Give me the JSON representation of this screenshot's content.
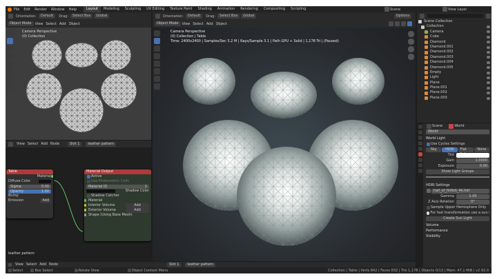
{
  "topbar": {
    "menus": [
      "File",
      "Edit",
      "Render",
      "Window",
      "Help"
    ],
    "workspaces": [
      "Layout",
      "Modeling",
      "Sculpting",
      "UV Editing",
      "Texture Paint",
      "Shading",
      "Animation",
      "Rendering",
      "Compositing",
      "Scripting"
    ],
    "active_workspace": "Layout",
    "scene": "Scene",
    "view_layer": "View Layer"
  },
  "left_viewport": {
    "header": {
      "orientation_label": "Orientation:",
      "orientation": "Default",
      "drag_label": "Drag:",
      "drag": "Select Box",
      "mode": "Object Mode",
      "menus": [
        "View",
        "Select",
        "Add",
        "Object"
      ],
      "transform": "Global"
    },
    "overlay_title": "Camera Perspective",
    "overlay_sub": "(0) Collection"
  },
  "render_viewport": {
    "header": {
      "orientation_label": "Orientation:",
      "orientation": "Default",
      "drag_label": "Drag:",
      "drag": "Select Box",
      "mode": "Object Mode",
      "menus": [
        "View",
        "Select",
        "Add",
        "Object"
      ],
      "transform": "Global",
      "options": "Options"
    },
    "overlay_title": "Camera Perspective",
    "overlay_sub": "(0) Collection | Table",
    "overlay_stats": "Time: 2400x2400 | Samples/Sec 3.2 M | Rays/Sample 3.1 | Path GPU + Solid | 1,178 Tri | (Paused)"
  },
  "node_editor": {
    "menus": [
      "View",
      "Select",
      "Add",
      "Node"
    ],
    "slot": "Slot 1",
    "material": "leather pattern",
    "label": "leather pattern",
    "node_table": {
      "title": "Table",
      "output": "Material",
      "rows": [
        {
          "label": "Diffuse Color",
          "value": ""
        },
        {
          "label": "Sigma",
          "value": "0.00"
        },
        {
          "label": "Opacity",
          "value": "1.00"
        },
        {
          "label": "Bump",
          "value": ""
        },
        {
          "label": "Emission",
          "value": "Add"
        }
      ]
    },
    "node_output": {
      "title": "Material Output",
      "active": "Active",
      "photo": "Use Photometric Cells",
      "slot": "Material ID",
      "slot_val": "1",
      "shadow_color": "Shadow Color",
      "shadow_catcher": "Shadow Catcher",
      "material": "Material",
      "interior": "Interior Volume",
      "interior_val": "Add",
      "exterior": "Exterior Volume",
      "exterior_val": "Add",
      "shape": "Shape (Using Base Mesh)"
    }
  },
  "bottom_bar": {
    "menus": [
      "View",
      "Select",
      "Add",
      "Node"
    ],
    "slot": "Slot 1",
    "material": "leather pattern",
    "status_left": [
      "Select",
      "Box Select",
      "Rotate View"
    ],
    "status_mid": "Object Context Menu",
    "status_right": "Collection | Table | Verts 842 | Faces 832 | Tris 1,178 | Objects 0/13 | Mem: 47.1 MiB | v2.92.0"
  },
  "outliner": {
    "title": "Scene Collection",
    "items": [
      {
        "name": "Collection",
        "color": "#c9c9c9"
      },
      {
        "name": "Camera",
        "color": "#8fb34a"
      },
      {
        "name": "Cube",
        "color": "#e08a39"
      },
      {
        "name": "Diamond",
        "color": "#e08a39"
      },
      {
        "name": "Diamond.001",
        "color": "#e08a39"
      },
      {
        "name": "Diamond.002",
        "color": "#e08a39"
      },
      {
        "name": "Diamond.003",
        "color": "#e08a39"
      },
      {
        "name": "Diamond.004",
        "color": "#e08a39"
      },
      {
        "name": "Diamond.005",
        "color": "#e08a39"
      },
      {
        "name": "Empty",
        "color": "#e08a39"
      },
      {
        "name": "Light",
        "color": "#e08a39"
      },
      {
        "name": "Plane",
        "color": "#e08a39"
      },
      {
        "name": "Plane.001",
        "color": "#e08a39"
      },
      {
        "name": "Plane.002",
        "color": "#e08a39"
      },
      {
        "name": "Plane.003",
        "color": "#e08a39"
      }
    ]
  },
  "properties": {
    "tabs": [
      "Scene",
      "World"
    ],
    "world_name": "World",
    "world_light": "World Light",
    "use_cycles": "Use Cycles Settings",
    "mode_tabs": [
      "Sky",
      "HDRI",
      "Flat Color",
      "None"
    ],
    "active_mode": "HDRI",
    "tint_label": "Tint",
    "gain_label": "Gain",
    "gain": "1.0000",
    "exposure_label": "Exposure",
    "exposure": "0.00",
    "show_groups": "Show Light Groups",
    "hdri_section": "HDRI Settings",
    "hdri_file": "hall_of_finfish_4k.hdr",
    "gamma_label": "Gamma",
    "gamma": "1.00",
    "zrot_label": "Z Axis Rotation",
    "zrot": "0°",
    "sample_upper": "Sample Upper Hemisphere Only",
    "sun_note": "For fast transformation use a sun light",
    "create_sun": "Create Sun Light",
    "sections": [
      "Volume",
      "Performance",
      "Visibility"
    ]
  },
  "colors": {
    "accent": "#4772b3",
    "node_header_red": "#b03a3a",
    "output_header": "#b03a3a",
    "output_body": "#3a5a3a"
  }
}
